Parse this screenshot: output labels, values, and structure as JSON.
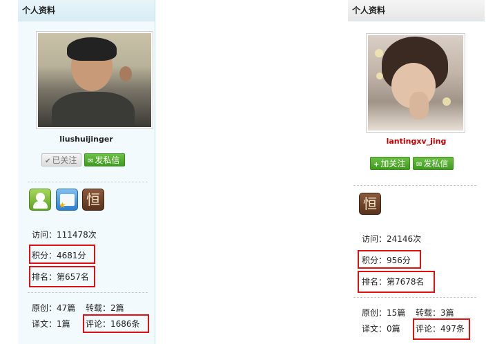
{
  "left": {
    "header": "个人资料",
    "username": "liushuijinger",
    "follow_label": "已关注",
    "message_label": "发私信",
    "badges": [
      "person-badge",
      "certificate-badge",
      "perseverance-badge"
    ],
    "badge_glyph": "恒",
    "visits": "访问：111478次",
    "points": "积分：4681分",
    "rank": "排名：第657名",
    "original": "原创：47篇",
    "repost": "转载：2篇",
    "translated": "译文：1篇",
    "comments": "评论：1686条"
  },
  "right": {
    "header": "个人资料",
    "username": "lantingxv_jing",
    "follow_label": "加关注",
    "message_label": "发私信",
    "badges": [
      "perseverance-badge"
    ],
    "badge_glyph": "恒",
    "visits": "访问：24146次",
    "points": "积分：956分",
    "rank": "排名：第7678名",
    "original": "原创：15篇",
    "repost": "转载：3篇",
    "translated": "译文：0篇",
    "comments": "评论：497条"
  },
  "colors": {
    "accent_green": "#4aa626",
    "highlight_red": "#e01010",
    "username_red": "#c00000"
  }
}
